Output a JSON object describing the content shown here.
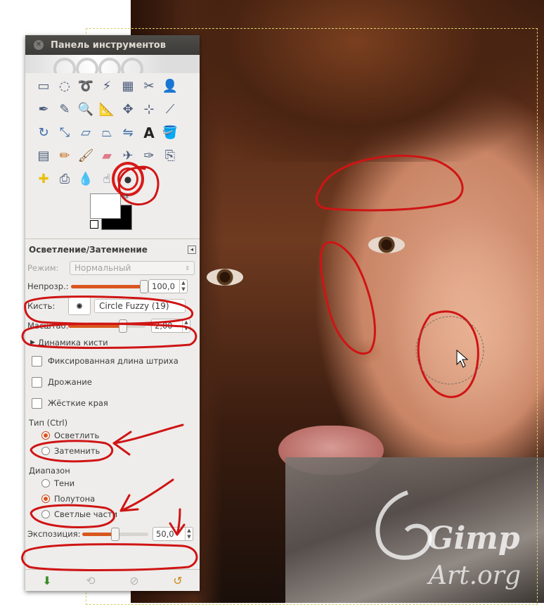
{
  "toolbox": {
    "title": "Панель инструментов",
    "tool_icons": [
      "rect-select-icon",
      "ellipse-select-icon",
      "lasso-icon",
      "fuzzy-select-icon",
      "color-select-icon",
      "scissors-icon",
      "foreground-select-icon",
      "paths-icon",
      "color-picker-icon",
      "zoom-icon",
      "measure-icon",
      "move-icon",
      "align-icon",
      "crop-icon",
      "rotate-icon",
      "scale-icon",
      "shear-icon",
      "perspective-icon",
      "flip-icon",
      "text-icon",
      "bucket-fill-icon",
      "blend-icon",
      "pencil-icon",
      "paintbrush-icon",
      "eraser-icon",
      "airbrush-icon",
      "ink-icon",
      "clone-icon",
      "heal-icon",
      "perspective-clone-icon",
      "blur-icon",
      "smudge-icon",
      "dodge-burn-icon"
    ],
    "active_tool": "dodge-burn-icon",
    "colors": {
      "foreground": "#ffffff",
      "background": "#000000"
    }
  },
  "tool_options": {
    "title": "Осветление/Затемнение",
    "mode_label": "Режим:",
    "mode_value": "Нормальный",
    "opacity_label": "Непрозр.:",
    "opacity_value": "100,0",
    "opacity_level": 1.0,
    "brush_label": "Кисть:",
    "brush_value": "Circle Fuzzy (19)",
    "scale_label": "Масштаб:",
    "scale_value": "2,00",
    "scale_level": 0.71,
    "dynamics_label": "Динамика кисти",
    "fixed_stroke_label": "Фиксированная длина штриха",
    "jitter_label": "Дрожание",
    "hard_edges_label": "Жёсткие края",
    "type_label": "Тип (Ctrl)",
    "type_options": [
      "Осветлить",
      "Затемнить"
    ],
    "type_selected": 0,
    "range_label": "Диапазон",
    "range_options": [
      "Тени",
      "Полутона",
      "Светлые части"
    ],
    "range_selected": 1,
    "exposure_label": "Экспозиция:",
    "exposure_value": "50,0",
    "exposure_level": 0.5
  },
  "bottom_icons": [
    "save-options-icon",
    "restore-options-icon",
    "delete-options-icon",
    "reset-options-icon"
  ],
  "watermark": {
    "line1": "Gimp",
    "line2": "Art.org"
  },
  "annotation_color": "#cf1414"
}
